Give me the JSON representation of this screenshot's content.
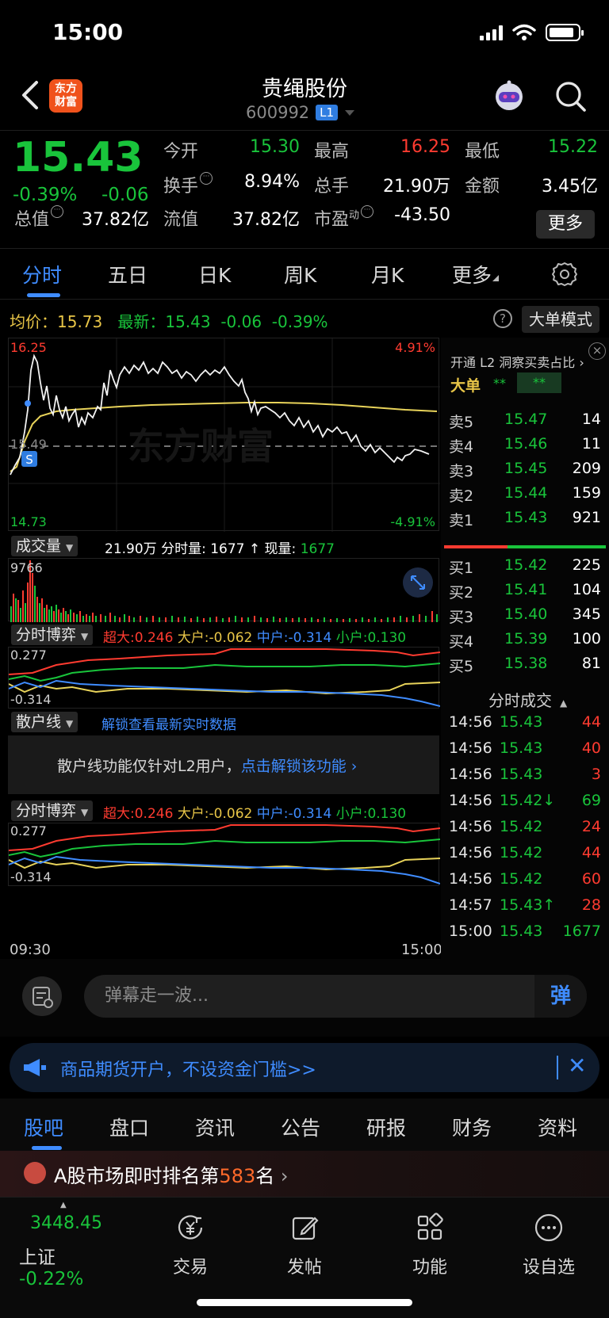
{
  "status_bar": {
    "time": "15:00"
  },
  "header": {
    "title": "贵绳股份",
    "code": "600992",
    "level_badge": "L1",
    "logo_text": "东方财富"
  },
  "quote": {
    "price": "15.43",
    "change_pct": "-0.39%",
    "change_abs": "-0.06",
    "fields": [
      {
        "label": "今开",
        "value": "15.30",
        "color": "green"
      },
      {
        "label": "最高",
        "value": "16.25",
        "color": "red"
      },
      {
        "label": "最低",
        "value": "15.22",
        "color": "green"
      },
      {
        "label": "换手",
        "value": "8.94%",
        "color": "white"
      },
      {
        "label": "总手",
        "value": "21.90万",
        "color": "white"
      },
      {
        "label": "金额",
        "value": "3.45亿",
        "color": "white"
      },
      {
        "label": "总值",
        "value": "37.82亿",
        "color": "white"
      },
      {
        "label": "流值",
        "value": "37.82亿",
        "color": "white"
      },
      {
        "label": "市盈",
        "value": "-43.50",
        "color": "white"
      }
    ],
    "pe_superscript": "动",
    "more_label": "更多"
  },
  "chart_tabs": [
    "分时",
    "五日",
    "日K",
    "周K",
    "月K",
    "更多"
  ],
  "info_row": {
    "avg_label": "均价：",
    "avg_value": "15.73",
    "latest_label": "最新：",
    "latest_value": "15.43",
    "latest_change": "-0.06",
    "latest_pct": "-0.39%",
    "big_mode": "大单模式",
    "help": "?"
  },
  "chart": {
    "y_high": "16.25",
    "y_low": "14.73",
    "pct_high": "4.91%",
    "pct_low": "-4.91%",
    "ref_price": "15.49",
    "watermark": "东方财富",
    "s_marker": "S",
    "time_start": "09:30",
    "time_end": "15:00"
  },
  "volume": {
    "label": "成交量",
    "total": "21.90万",
    "tick_label": "分时量:",
    "tick_value": "1677",
    "cur_label": "现量:",
    "cur_value": "1677",
    "max": "9766"
  },
  "game1": {
    "label": "分时博弈",
    "super_label": "超大:",
    "super_val": "0.246",
    "big_label": "大户:",
    "big_val": "-0.062",
    "mid_label": "中户:",
    "mid_val": "-0.314",
    "small_label": "小户:",
    "small_val": "0.130",
    "top": "0.277",
    "bottom": "-0.314"
  },
  "retail": {
    "label": "散户线",
    "unlock_text": "解锁查看最新实时数据",
    "notice": "散户线功能仅针对L2用户，",
    "notice_link": "点击解锁该功能"
  },
  "game2": {
    "label": "分时博弈",
    "super_label": "超大:",
    "super_val": "0.246",
    "big_label": "大户:",
    "big_val": "-0.062",
    "mid_label": "中户:",
    "mid_val": "-0.314",
    "small_label": "小户:",
    "small_val": "0.130",
    "top": "0.277",
    "bottom": "-0.314"
  },
  "orderbook": {
    "header": "开通 L2 洞察买卖占比",
    "big_label": "大单",
    "big_a": "**",
    "big_b": "**",
    "asks": [
      {
        "label": "卖5",
        "price": "15.47",
        "vol": "14"
      },
      {
        "label": "卖4",
        "price": "15.46",
        "vol": "11"
      },
      {
        "label": "卖3",
        "price": "15.45",
        "vol": "209"
      },
      {
        "label": "卖2",
        "price": "15.44",
        "vol": "159"
      },
      {
        "label": "卖1",
        "price": "15.43",
        "vol": "921"
      }
    ],
    "bids": [
      {
        "label": "买1",
        "price": "15.42",
        "vol": "225"
      },
      {
        "label": "买2",
        "price": "15.41",
        "vol": "104"
      },
      {
        "label": "买3",
        "price": "15.40",
        "vol": "345"
      },
      {
        "label": "买4",
        "price": "15.39",
        "vol": "100"
      },
      {
        "label": "买5",
        "price": "15.38",
        "vol": "81"
      }
    ],
    "ticks_title": "分时成交",
    "ticks": [
      {
        "time": "14:56",
        "price": "15.43",
        "vol": "44",
        "color": "red"
      },
      {
        "time": "14:56",
        "price": "15.43",
        "vol": "40",
        "color": "red"
      },
      {
        "time": "14:56",
        "price": "15.43",
        "vol": "3",
        "color": "red"
      },
      {
        "time": "14:56",
        "price": "15.42↓",
        "vol": "69",
        "color": "green"
      },
      {
        "time": "14:56",
        "price": "15.42",
        "vol": "24",
        "color": "red"
      },
      {
        "time": "14:56",
        "price": "15.42",
        "vol": "44",
        "color": "red"
      },
      {
        "time": "14:56",
        "price": "15.42",
        "vol": "60",
        "color": "red"
      },
      {
        "time": "14:57",
        "price": "15.43↑",
        "vol": "28",
        "color": "red"
      },
      {
        "time": "15:00",
        "price": "15.43",
        "vol": "1677",
        "color": "green"
      }
    ]
  },
  "comment": {
    "placeholder": "弹幕走一波...",
    "send": "弹"
  },
  "banner": {
    "text": "商品期货开户，不设资金门槛>>"
  },
  "bottom_tabs": [
    "股吧",
    "盘口",
    "资讯",
    "公告",
    "研报",
    "财务",
    "资料"
  ],
  "rank": {
    "prefix": "A股市场即时排名第",
    "number": "583",
    "suffix": "名"
  },
  "bottom_nav": {
    "index_value": "3448.45",
    "index_name": "上证",
    "index_change": "-0.22%",
    "items": [
      "交易",
      "发帖",
      "功能",
      "设自选"
    ]
  },
  "colors": {
    "up": "#ff3b30",
    "down": "#19c43b",
    "accent": "#3f8cff",
    "avg": "#e8c547"
  }
}
